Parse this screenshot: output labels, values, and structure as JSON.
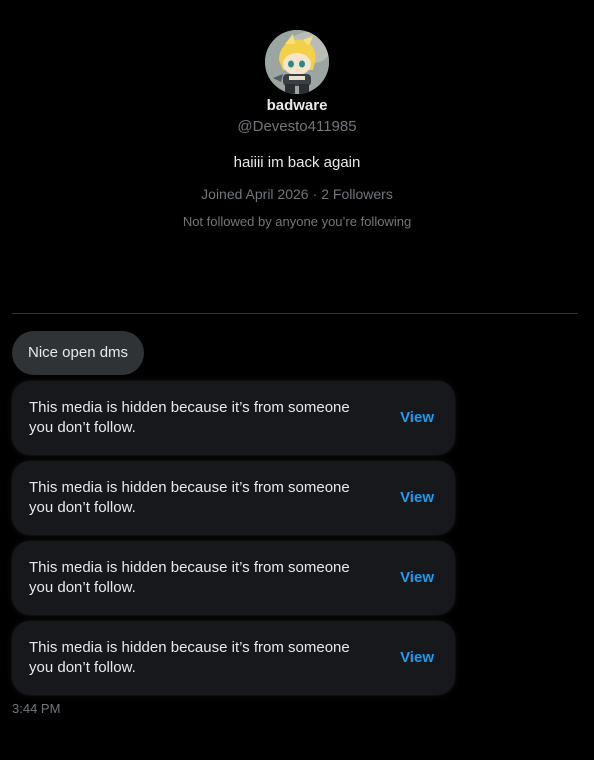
{
  "profile": {
    "name": "badware",
    "handle": "@Devesto411985",
    "bio": "haiiii im back again",
    "joined": "Joined April 2026",
    "separator": "·",
    "followers": "2 Followers",
    "followed_by": "Not followed by anyone you’re following"
  },
  "messages": {
    "text_message": "Nice open dms",
    "hidden_media": [
      {
        "text": "This media is hidden because it’s from someone you don’t follow.",
        "action": "View"
      },
      {
        "text": "This media is hidden because it’s from someone you don’t follow.",
        "action": "View"
      },
      {
        "text": "This media is hidden because it’s from someone you don’t follow.",
        "action": "View"
      },
      {
        "text": "This media is hidden because it’s from someone you don’t follow.",
        "action": "View"
      }
    ],
    "timestamp": "3:44 PM"
  },
  "colors": {
    "background": "#000000",
    "accent": "#1d9bf0",
    "muted_text": "#71767b",
    "bubble": "#2f3336",
    "card": "#16181c"
  },
  "icons": {
    "avatar": "plush-doll-avatar"
  }
}
